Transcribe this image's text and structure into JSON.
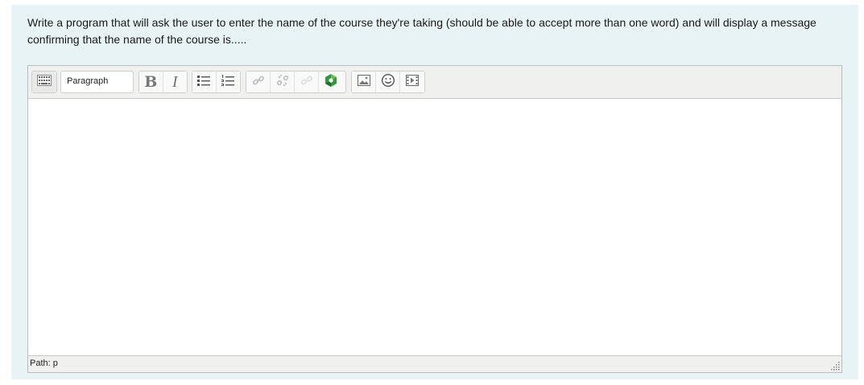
{
  "question": {
    "text": "Write a program that will ask the user to enter the name of the course they're taking (should be able to accept more than one word) and will display a message confirming that the name of the course is....."
  },
  "editor": {
    "format_select": {
      "value": "Paragraph"
    },
    "toolbar": {
      "bold_glyph": "B",
      "italic_glyph": "I",
      "icons": [
        "toolbar-toggle-icon",
        "unordered-list-icon",
        "ordered-list-icon",
        "link-icon",
        "unlink-icon",
        "no-autolink-icon",
        "recordrtc-icon",
        "image-icon",
        "emoticon-icon",
        "media-icon"
      ]
    },
    "content": "",
    "statusbar": {
      "path": "Path: p"
    }
  },
  "colors": {
    "panel_bg": "#e7f3f5",
    "toolbar_bg": "#f0f0ee",
    "recordrtc_green": "#2e9a3b"
  }
}
